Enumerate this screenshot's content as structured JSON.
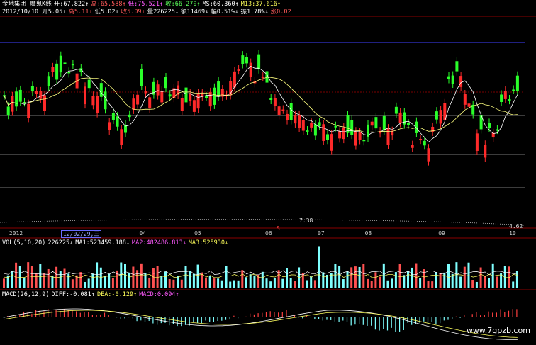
{
  "header": {
    "line1": [
      {
        "text": "金地集团 魔鬼K线",
        "color": "#ffffff"
      },
      {
        "text": "开:67.822↑",
        "color": "#ffffff"
      },
      {
        "text": "高:65.588↑",
        "color": "#ff5a5a"
      },
      {
        "text": "低:75.521↑",
        "color": "#ff5aff"
      },
      {
        "text": "收:66.270↑",
        "color": "#5aff5a"
      },
      {
        "text": "MS:60.360↑",
        "color": "#ffffff"
      },
      {
        "text": "M13:37.616↑",
        "color": "#ffff5a"
      }
    ],
    "line2": [
      {
        "text": "2012/10/10 开5.05↑",
        "color": "#ffffff"
      },
      {
        "text": "高5.11↑",
        "color": "#ff5a5a"
      },
      {
        "text": "低5.02↑",
        "color": "#ffffff"
      },
      {
        "text": "收5.09↑",
        "color": "#ff5a5a"
      },
      {
        "text": "量226225↓",
        "color": "#ffffff"
      },
      {
        "text": "额11469↓",
        "color": "#ffffff"
      },
      {
        "text": "幅0.51%↓",
        "color": "#ffffff"
      },
      {
        "text": "振1.78%↓",
        "color": "#ffffff"
      },
      {
        "text": "涨0.02",
        "color": "#ff5a5a"
      }
    ]
  },
  "price_markers": {
    "left_value": "7.38",
    "right_value": "4.62",
    "s_label": "S"
  },
  "x_axis": {
    "labels": [
      {
        "text": "2012",
        "pos": 0.012
      },
      {
        "text": "04",
        "pos": 0.26
      },
      {
        "text": "05",
        "pos": 0.365
      },
      {
        "text": "06",
        "pos": 0.5
      },
      {
        "text": "07",
        "pos": 0.6
      },
      {
        "text": "08",
        "pos": 0.69
      },
      {
        "text": "09",
        "pos": 0.83
      },
      {
        "text": "10",
        "pos": 0.965
      }
    ],
    "cursor_date": "12/02/29,三"
  },
  "vol_header": [
    {
      "text": "VOL(5,10,20)",
      "color": "#ffffff"
    },
    {
      "text": "226225↓",
      "color": "#ffffff"
    },
    {
      "text": "MA1:523459.188↓",
      "color": "#ffffff"
    },
    {
      "text": "MA2:482486.813↓",
      "color": "#ff5aff"
    },
    {
      "text": "MA3:525930↓",
      "color": "#ffff5a"
    }
  ],
  "macd_header": [
    {
      "text": "MACD(26,12,9)",
      "color": "#ffffff"
    },
    {
      "text": "DIFF:-0.081↑",
      "color": "#ffffff"
    },
    {
      "text": "DEA:-0.129↑",
      "color": "#ffff5a"
    },
    {
      "text": "MACD:0.094↑",
      "color": "#ff5aff"
    }
  ],
  "watermark": "www.7gpzb.com",
  "colors": {
    "up": "#ff2a2a",
    "down": "#2aff2a",
    "vol_down": "#7fffff",
    "grid": "#7a0000",
    "blue_line": "#4040ff",
    "ma1": "#ffffff",
    "ma2": "#ffff80"
  }
}
